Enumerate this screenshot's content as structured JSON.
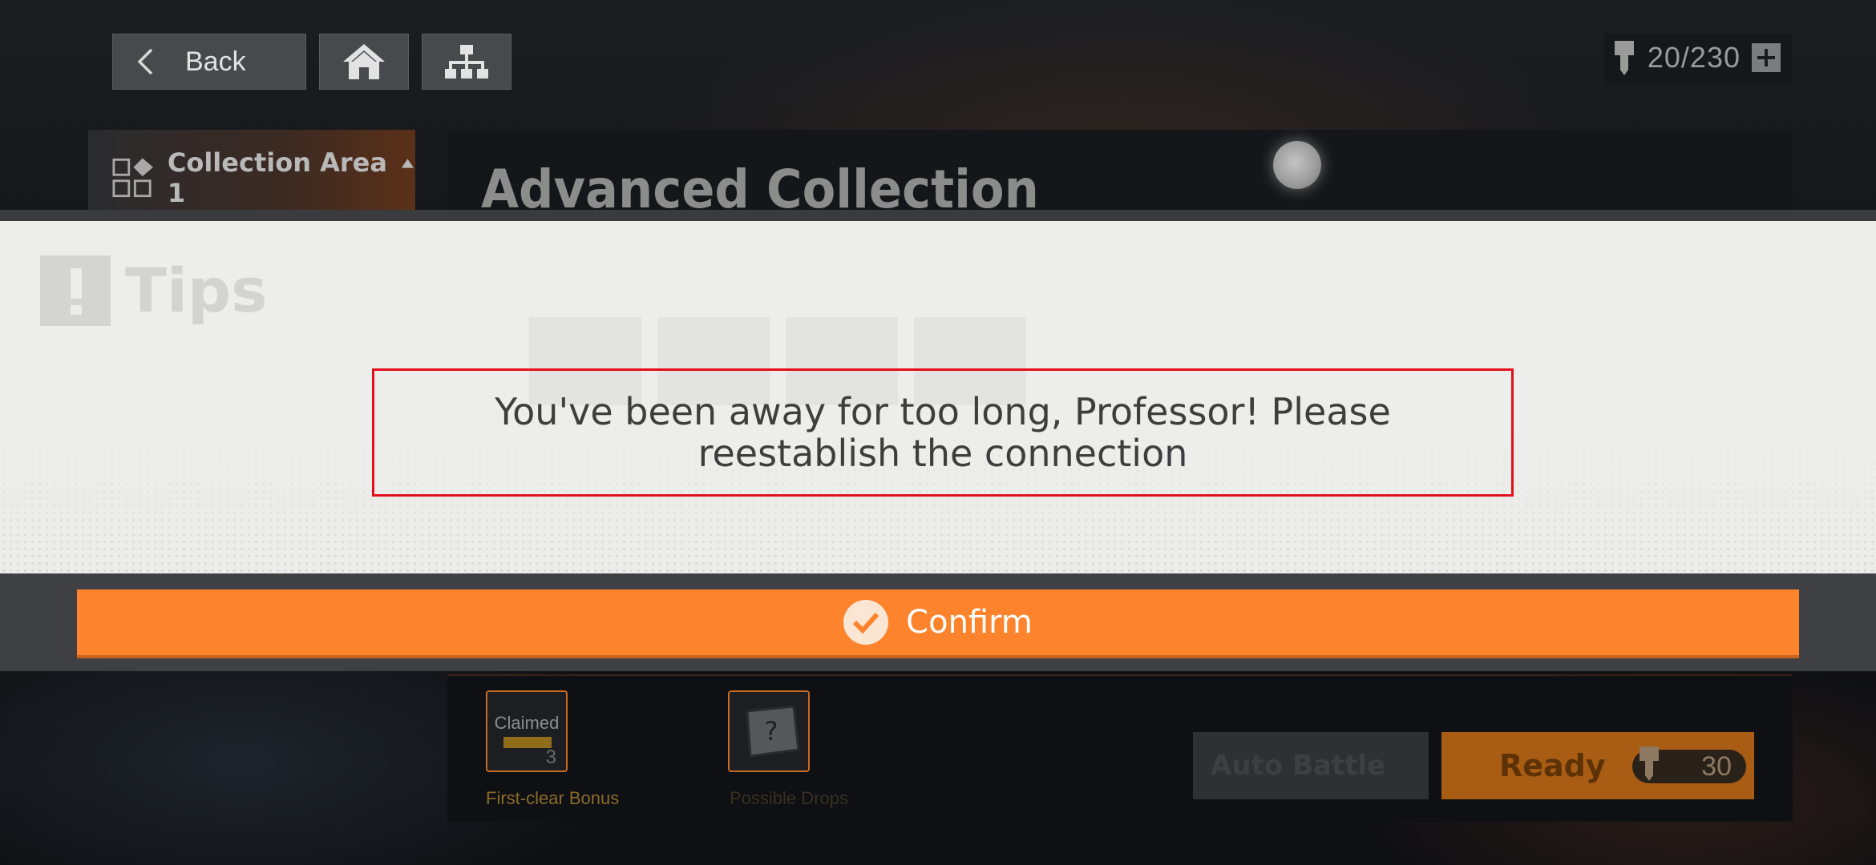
{
  "topbar": {
    "back_label": "Back",
    "stamina": "20/230"
  },
  "stage": {
    "area_label": "Collection Area 1",
    "title": "Advanced Collection"
  },
  "dialog": {
    "title": "Tips",
    "message": "You've been away for too long, Professor! Please reestablish the connection",
    "confirm_label": "Confirm"
  },
  "rewards": {
    "claimed_label": "Claimed",
    "claimed_qty": "3",
    "first_clear_caption": "First-clear Bonus",
    "possible_drops_caption": "Possible Drops"
  },
  "actions": {
    "auto_battle_label": "Auto Battle",
    "ready_label": "Ready",
    "ready_cost": "30"
  },
  "colors": {
    "confirm": "#fd832c",
    "highlight_border": "#e3101c",
    "dialog_bg": "#ededeb"
  }
}
